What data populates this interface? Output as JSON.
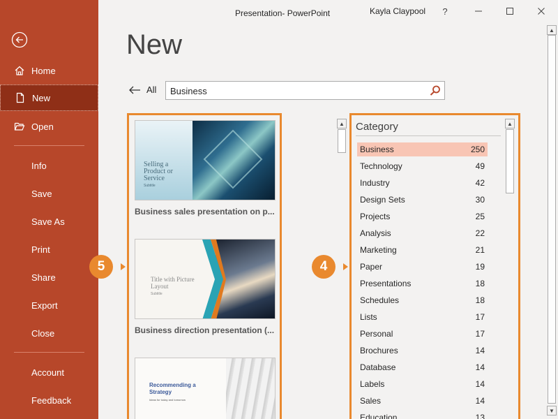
{
  "window": {
    "title": "Presentation- PowerPoint",
    "user": "Kayla Claypool",
    "help_symbol": "?",
    "min_symbol": "—",
    "max_symbol": "☐",
    "close_symbol": "✕"
  },
  "sidebar": {
    "back_icon": "back-arrow-icon",
    "items": [
      {
        "label": "Home",
        "icon": "home-icon"
      },
      {
        "label": "New",
        "icon": "new-document-icon",
        "active": true
      },
      {
        "label": "Open",
        "icon": "folder-open-icon"
      },
      {
        "label": "Info"
      },
      {
        "label": "Save"
      },
      {
        "label": "Save As"
      },
      {
        "label": "Print"
      },
      {
        "label": "Share"
      },
      {
        "label": "Export"
      },
      {
        "label": "Close"
      },
      {
        "label": "Account"
      },
      {
        "label": "Feedback"
      }
    ]
  },
  "main": {
    "title": "New",
    "all_label": "All",
    "search": {
      "value": "Business"
    }
  },
  "templates": [
    {
      "name": "Business sales presentation on p...",
      "thumb_title": "Selling a Product or Service",
      "thumb_subtitle": "Subtitle"
    },
    {
      "name": "Business direction presentation (...",
      "thumb_title": "Title with Picture Layout",
      "thumb_subtitle": "Subtitle"
    },
    {
      "name": "",
      "thumb_title": "Recommending a Strategy",
      "thumb_subtitle": "Ideas for today and tomorrow"
    }
  ],
  "callouts": {
    "templates": "5",
    "category": "4"
  },
  "category": {
    "heading": "Category",
    "items": [
      {
        "label": "Business",
        "count": "250",
        "selected": true
      },
      {
        "label": "Technology",
        "count": "49"
      },
      {
        "label": "Industry",
        "count": "42"
      },
      {
        "label": "Design Sets",
        "count": "30"
      },
      {
        "label": "Projects",
        "count": "25"
      },
      {
        "label": "Analysis",
        "count": "22"
      },
      {
        "label": "Marketing",
        "count": "21"
      },
      {
        "label": "Paper",
        "count": "19"
      },
      {
        "label": "Presentations",
        "count": "18"
      },
      {
        "label": "Schedules",
        "count": "18"
      },
      {
        "label": "Lists",
        "count": "17"
      },
      {
        "label": "Personal",
        "count": "17"
      },
      {
        "label": "Brochures",
        "count": "14"
      },
      {
        "label": "Database",
        "count": "14"
      },
      {
        "label": "Labels",
        "count": "14"
      },
      {
        "label": "Sales",
        "count": "14"
      },
      {
        "label": "Education",
        "count": "13"
      }
    ]
  },
  "colors": {
    "accent": "#b7472a",
    "callout": "#e9892e",
    "selected": "#f8c5b4"
  }
}
